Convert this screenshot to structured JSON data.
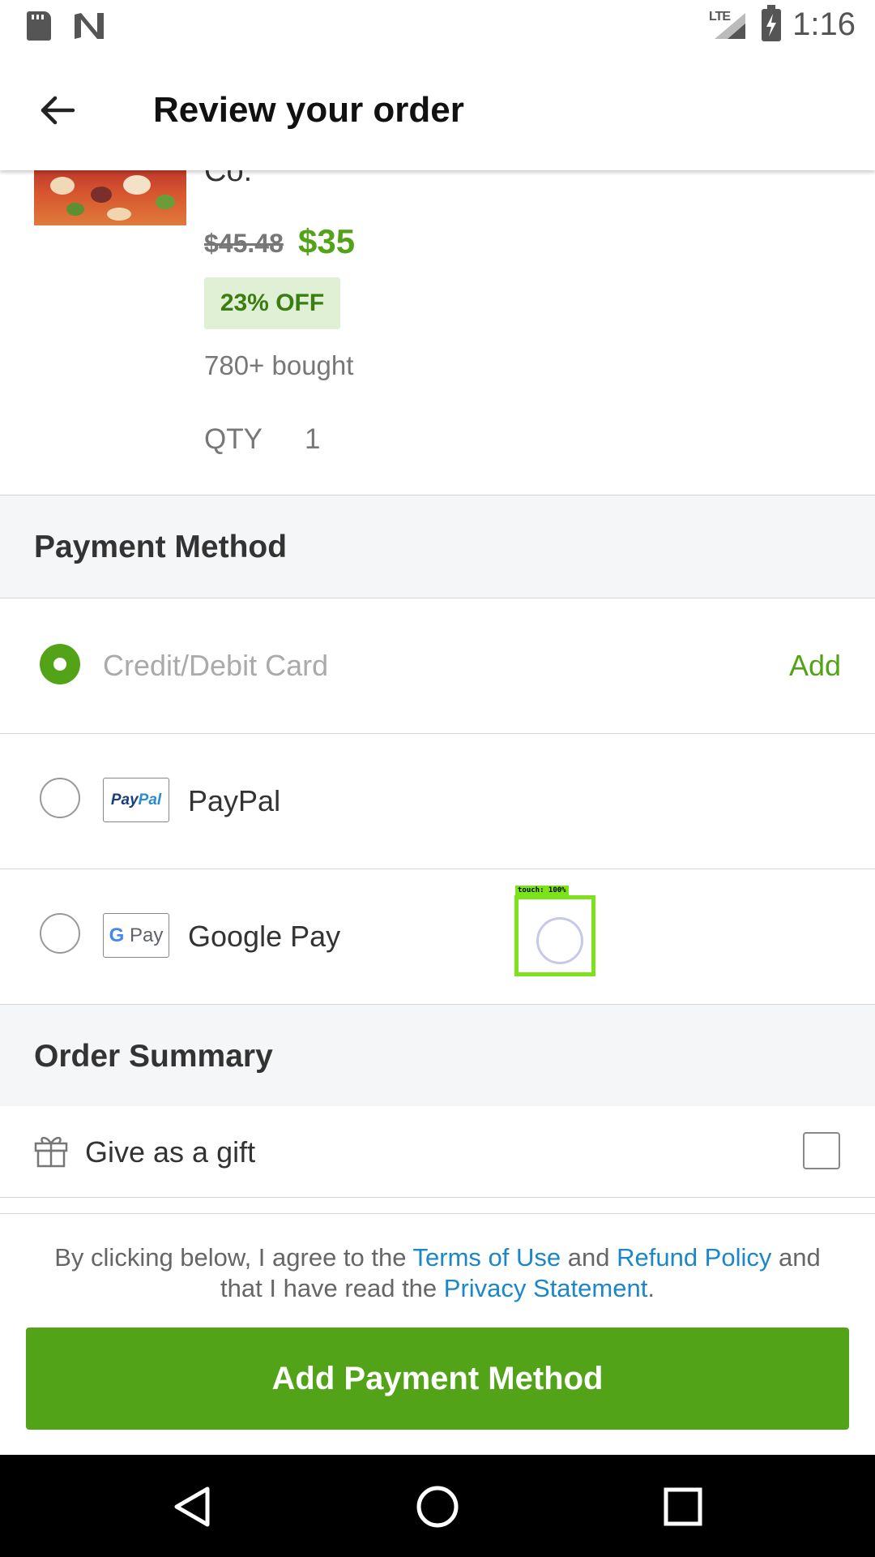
{
  "status_bar": {
    "network": "LTE",
    "time": "1:16"
  },
  "app_bar": {
    "title": "Review your order"
  },
  "product": {
    "name_tail": "Co.",
    "price_old": "$45.48",
    "price_new": "$35",
    "discount": "23% OFF",
    "bought": "780+ bought",
    "qty_label": "QTY",
    "qty_value": "1"
  },
  "payment": {
    "header": "Payment Method",
    "options": [
      {
        "label": "Credit/Debit Card",
        "action": "Add",
        "selected": true
      },
      {
        "label": "PayPal",
        "logo_text": [
          "Pay",
          "Pal"
        ],
        "selected": false
      },
      {
        "label": "Google Pay",
        "logo_text": [
          "G",
          "Pay"
        ],
        "selected": false
      }
    ]
  },
  "touch_indicator": {
    "label": "touch: 100%"
  },
  "summary": {
    "header": "Order Summary",
    "gift_label": "Give as a gift"
  },
  "footer": {
    "terms_prefix": "By clicking below, I agree to the ",
    "terms_link": "Terms of Use",
    "and_1": " and ",
    "refund_link": "Refund Policy",
    "and_2": " and that I have read the ",
    "privacy_link": "Privacy Statement",
    "terms_suffix": ".",
    "cta": "Add Payment Method"
  },
  "colors": {
    "accent": "#53a318",
    "link": "#1b87c9",
    "badge_bg": "#dff0d4"
  }
}
